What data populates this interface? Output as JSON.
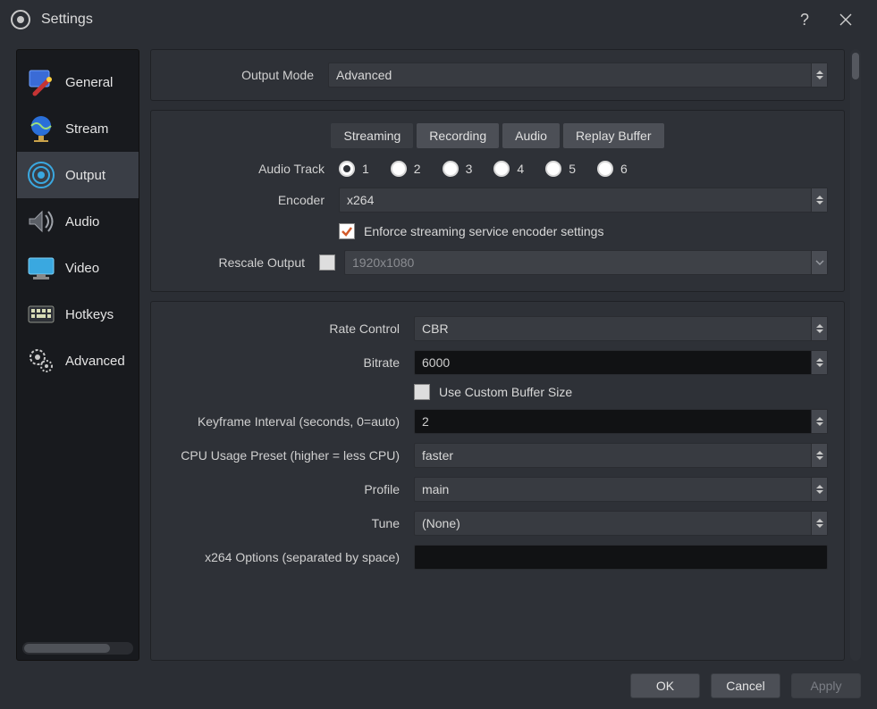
{
  "window": {
    "title": "Settings"
  },
  "sidebar": {
    "items": [
      {
        "label": "General",
        "icon": "general-icon"
      },
      {
        "label": "Stream",
        "icon": "stream-icon"
      },
      {
        "label": "Output",
        "icon": "output-icon",
        "selected": true
      },
      {
        "label": "Audio",
        "icon": "audio-icon"
      },
      {
        "label": "Video",
        "icon": "video-icon"
      },
      {
        "label": "Hotkeys",
        "icon": "hotkeys-icon"
      },
      {
        "label": "Advanced",
        "icon": "advanced-icon"
      }
    ]
  },
  "output_mode": {
    "label": "Output Mode",
    "value": "Advanced"
  },
  "tabs": [
    {
      "label": "Streaming",
      "active": true
    },
    {
      "label": "Recording"
    },
    {
      "label": "Audio"
    },
    {
      "label": "Replay Buffer"
    }
  ],
  "streaming": {
    "audio_track": {
      "label": "Audio Track",
      "options": [
        "1",
        "2",
        "3",
        "4",
        "5",
        "6"
      ],
      "selected": "1"
    },
    "encoder": {
      "label": "Encoder",
      "value": "x264"
    },
    "enforce": {
      "label": "Enforce streaming service encoder settings",
      "checked": true
    },
    "rescale": {
      "label": "Rescale Output",
      "checked": false,
      "value": "1920x1080"
    }
  },
  "encoder_settings": {
    "rate_control": {
      "label": "Rate Control",
      "value": "CBR"
    },
    "bitrate": {
      "label": "Bitrate",
      "value": "6000"
    },
    "custom_buffer": {
      "label": "Use Custom Buffer Size",
      "checked": false
    },
    "keyframe": {
      "label": "Keyframe Interval (seconds, 0=auto)",
      "value": "2"
    },
    "cpu_preset": {
      "label": "CPU Usage Preset (higher = less CPU)",
      "value": "faster"
    },
    "profile": {
      "label": "Profile",
      "value": "main"
    },
    "tune": {
      "label": "Tune",
      "value": "(None)"
    },
    "x264_opts": {
      "label": "x264 Options (separated by space)",
      "value": ""
    }
  },
  "footer": {
    "ok": "OK",
    "cancel": "Cancel",
    "apply": "Apply"
  }
}
